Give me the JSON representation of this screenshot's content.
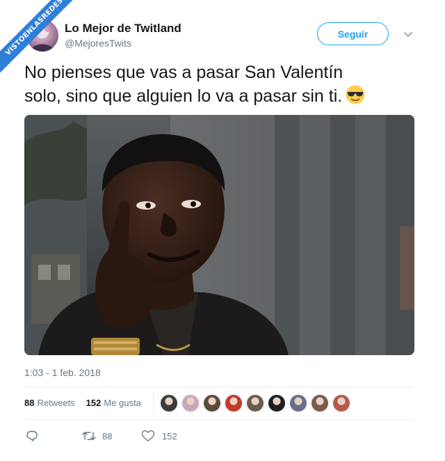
{
  "watermark": {
    "text": "VISTOENLASREDES"
  },
  "header": {
    "display_name": "Lo Mejor de Twitland",
    "handle": "@MejoresTwits",
    "follow_label": "Seguir"
  },
  "tweet": {
    "text_line1": "No pienses que vas a pasar San Valentín",
    "text_line2": "solo, sino que alguien lo va a pasar sin ti.",
    "emoji": "smiling-face-with-sunglasses",
    "timestamp": "1:03 - 1 feb. 2018"
  },
  "stats": {
    "retweets_count": "88",
    "retweets_label": "Retweets",
    "likes_count": "152",
    "likes_label": "Me gusta",
    "liker_avatar_colors": [
      "#3b3b3b",
      "#c9a7b8",
      "#5a4a3a",
      "#c0392b",
      "#6b5a4e",
      "#1f1f1f",
      "#6a6d8a",
      "#7a5a4a",
      "#b55a4a"
    ]
  },
  "actions": {
    "reply_count": "",
    "retweet_count": "88",
    "like_count": "152"
  },
  "colors": {
    "accent": "#1da1f2",
    "muted": "#657786",
    "text": "#14171a",
    "watermark": "#2f7fd8"
  }
}
